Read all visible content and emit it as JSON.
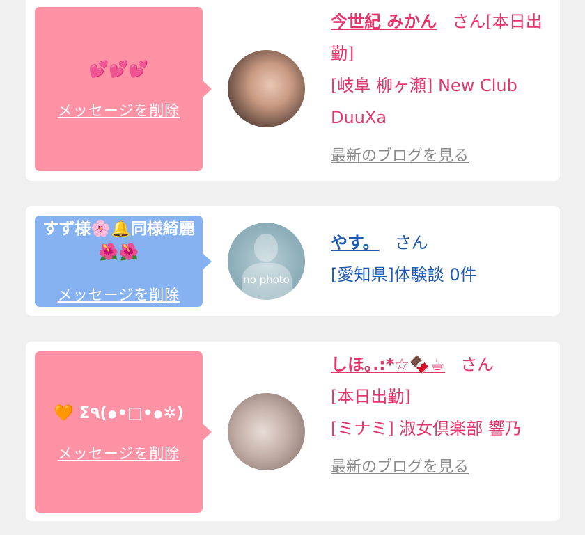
{
  "cards": [
    {
      "message": "💕💕💕",
      "delete_label": "メッセージを削除",
      "name": "今世紀 みかん",
      "honorific": "さん",
      "status": "[本日出勤]",
      "shop": "[岐阜 柳ヶ瀬] New Club DuuXa",
      "blog_link": "最新のブログを見る",
      "bubble_color": "#fd92a5"
    },
    {
      "message": "すず様🌸🔔同様綺麗🌺🌺",
      "delete_label": "メッセージを削除",
      "name": "やす。",
      "honorific": "さん",
      "avatar_text": "no photo",
      "detail": "[愛知県]体験談 0件",
      "bubble_color": "#86b2f1"
    },
    {
      "message": "🧡 Σ٩(๑•□•๑✲)",
      "delete_label": "メッセージを削除",
      "name": "しほ｡.:*☆🍫☕",
      "honorific": "さん",
      "status": "[本日出勤]",
      "shop": "[ミナミ] 淑女倶楽部 響乃",
      "blog_link": "最新のブログを見る",
      "bubble_color": "#fd92a5"
    }
  ],
  "colors": {
    "pink_accent": "#e3366a",
    "blue_accent": "#1f5bb3",
    "gray_link": "#8b8b8b",
    "background": "#f0f0f0"
  }
}
